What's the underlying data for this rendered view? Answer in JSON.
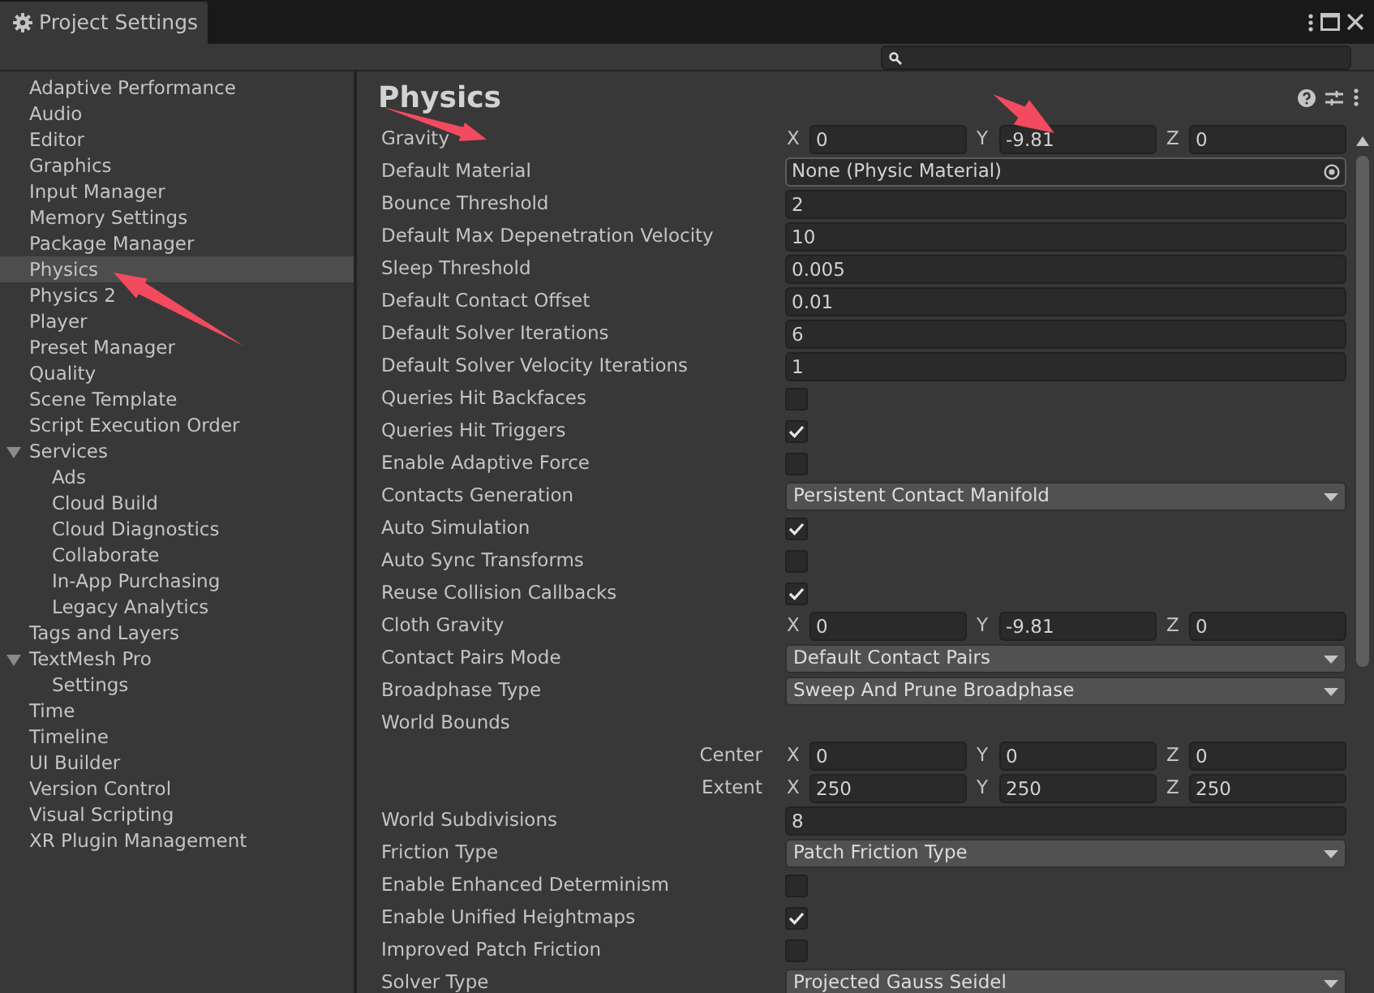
{
  "window": {
    "title": "Project Settings"
  },
  "sidebar": {
    "items": [
      {
        "label": "Adaptive Performance",
        "selected": false
      },
      {
        "label": "Audio",
        "selected": false
      },
      {
        "label": "Editor",
        "selected": false
      },
      {
        "label": "Graphics",
        "selected": false
      },
      {
        "label": "Input Manager",
        "selected": false
      },
      {
        "label": "Memory Settings",
        "selected": false
      },
      {
        "label": "Package Manager",
        "selected": false
      },
      {
        "label": "Physics",
        "selected": true
      },
      {
        "label": "Physics 2",
        "selected": false
      },
      {
        "label": "Player",
        "selected": false
      },
      {
        "label": "Preset Manager",
        "selected": false
      },
      {
        "label": "Quality",
        "selected": false
      },
      {
        "label": "Scene Template",
        "selected": false
      },
      {
        "label": "Script Execution Order",
        "selected": false
      },
      {
        "label": "Services",
        "selected": false,
        "expanded": true,
        "children": [
          {
            "label": "Ads",
            "selected": false
          },
          {
            "label": "Cloud Build",
            "selected": false
          },
          {
            "label": "Cloud Diagnostics",
            "selected": false
          },
          {
            "label": "Collaborate",
            "selected": false
          },
          {
            "label": "In-App Purchasing",
            "selected": false
          },
          {
            "label": "Legacy Analytics",
            "selected": false
          }
        ]
      },
      {
        "label": "Tags and Layers",
        "selected": false
      },
      {
        "label": "TextMesh Pro",
        "selected": false,
        "expanded": true,
        "children": [
          {
            "label": "Settings",
            "selected": false
          }
        ]
      },
      {
        "label": "Time",
        "selected": false
      },
      {
        "label": "Timeline",
        "selected": false
      },
      {
        "label": "UI Builder",
        "selected": false
      },
      {
        "label": "Version Control",
        "selected": false
      },
      {
        "label": "Visual Scripting",
        "selected": false
      },
      {
        "label": "XR Plugin Management",
        "selected": false
      }
    ]
  },
  "panel": {
    "title": "Physics",
    "rows": [
      {
        "kind": "vector",
        "label": "Gravity",
        "components": [
          {
            "axis": "X",
            "value": "0"
          },
          {
            "axis": "Y",
            "value": "-9.81"
          },
          {
            "axis": "Z",
            "value": "0"
          }
        ]
      },
      {
        "kind": "object",
        "label": "Default Material",
        "value": "None (Physic Material)"
      },
      {
        "kind": "number",
        "label": "Bounce Threshold",
        "value": "2"
      },
      {
        "kind": "number",
        "label": "Default Max Depenetration Velocity",
        "value": "10"
      },
      {
        "kind": "number",
        "label": "Sleep Threshold",
        "value": "0.005"
      },
      {
        "kind": "number",
        "label": "Default Contact Offset",
        "value": "0.01"
      },
      {
        "kind": "number",
        "label": "Default Solver Iterations",
        "value": "6"
      },
      {
        "kind": "number",
        "label": "Default Solver Velocity Iterations",
        "value": "1"
      },
      {
        "kind": "checkbox",
        "label": "Queries Hit Backfaces",
        "checked": false
      },
      {
        "kind": "checkbox",
        "label": "Queries Hit Triggers",
        "checked": true
      },
      {
        "kind": "checkbox",
        "label": "Enable Adaptive Force",
        "checked": false
      },
      {
        "kind": "dropdown",
        "label": "Contacts Generation",
        "value": "Persistent Contact Manifold"
      },
      {
        "kind": "checkbox",
        "label": "Auto Simulation",
        "checked": true
      },
      {
        "kind": "checkbox",
        "label": "Auto Sync Transforms",
        "checked": false
      },
      {
        "kind": "checkbox",
        "label": "Reuse Collision Callbacks",
        "checked": true
      },
      {
        "kind": "vector",
        "label": "Cloth Gravity",
        "components": [
          {
            "axis": "X",
            "value": "0"
          },
          {
            "axis": "Y",
            "value": "-9.81"
          },
          {
            "axis": "Z",
            "value": "0"
          }
        ]
      },
      {
        "kind": "dropdown",
        "label": "Contact Pairs Mode",
        "value": "Default Contact Pairs"
      },
      {
        "kind": "dropdown",
        "label": "Broadphase Type",
        "value": "Sweep And Prune Broadphase"
      },
      {
        "kind": "heading",
        "label": "World Bounds"
      },
      {
        "kind": "subvector",
        "label": "Center",
        "components": [
          {
            "axis": "X",
            "value": "0"
          },
          {
            "axis": "Y",
            "value": "0"
          },
          {
            "axis": "Z",
            "value": "0"
          }
        ]
      },
      {
        "kind": "subvector",
        "label": "Extent",
        "components": [
          {
            "axis": "X",
            "value": "250"
          },
          {
            "axis": "Y",
            "value": "250"
          },
          {
            "axis": "Z",
            "value": "250"
          }
        ]
      },
      {
        "kind": "number",
        "label": "World Subdivisions",
        "value": "8"
      },
      {
        "kind": "dropdown",
        "label": "Friction Type",
        "value": "Patch Friction Type"
      },
      {
        "kind": "checkbox",
        "label": "Enable Enhanced Determinism",
        "checked": false
      },
      {
        "kind": "checkbox",
        "label": "Enable Unified Heightmaps",
        "checked": true
      },
      {
        "kind": "checkbox",
        "label": "Improved Patch Friction",
        "checked": false
      },
      {
        "kind": "dropdown",
        "label": "Solver Type",
        "value": "Projected Gauss Seidel"
      }
    ]
  }
}
